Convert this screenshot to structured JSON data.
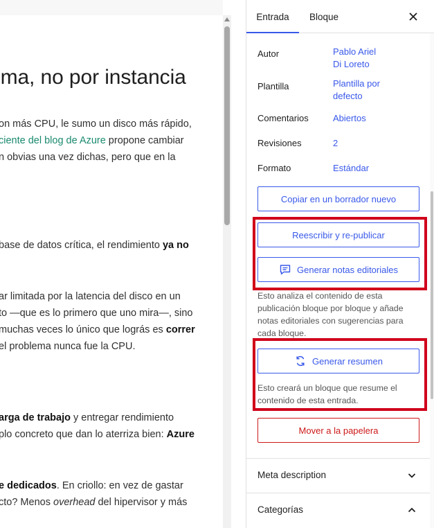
{
  "editor": {
    "title": "ema, no por instancia",
    "paragraphs": [
      [
        "on más CPU, le sumo un disco más rápido,",
        "ciente del blog de Azure propone cambiar",
        "n obvias una vez dichas, pero que en la"
      ],
      [
        "base de datos crítica, el rendimiento ",
        "ya no"
      ],
      [
        "ar limitada por la latencia del disco en un",
        "to —que es lo primero que uno mira—, sino",
        "muchas veces lo único que lográs es ",
        "correr",
        "el problema nunca fue la CPU."
      ],
      [
        "arga de trabajo",
        " y entregar rendimiento",
        "plo concreto que dan lo aterriza bien: ",
        "Azure"
      ],
      [
        "e dedicados",
        ". En criollo: en vez de gastar",
        "cto? Menos ",
        "overhead",
        " del hipervisor y más"
      ]
    ],
    "link_text": "ciente del blog de Azure",
    "link_rest": " propone cambiar"
  },
  "sidebar": {
    "tabs": [
      "Entrada",
      "Bloque"
    ],
    "cut_text": "instancia",
    "rows": {
      "autor_label": "Autor",
      "autor_value_1": "Pablo Ariel",
      "autor_value_2": "Di Loreto",
      "plantilla_label": "Plantilla",
      "plantilla_value_1": "Plantilla por",
      "plantilla_value_2": "defecto",
      "comentarios_label": "Comentarios",
      "comentarios_value": "Abiertos",
      "revisiones_label": "Revisiones",
      "revisiones_value": "2",
      "formato_label": "Formato",
      "formato_value": "Estándar"
    },
    "buttons": {
      "copy_draft": "Copiar en un borrador nuevo",
      "rewrite": "Reescribir y re-publicar",
      "editorial_notes": "Generar notas editoriales",
      "summary": "Generar resumen",
      "trash": "Mover a la papelera"
    },
    "help": {
      "editorial": "Esto analiza el contenido de esta publicación bloque por bloque y añade notas editoriales con sugerencias para cada bloque.",
      "summary": "Esto creará un bloque que resume el contenido de esta entrada."
    },
    "panels": {
      "meta": "Meta description",
      "categories": "Categorías"
    }
  },
  "colors": {
    "accent": "#3858e9",
    "danger": "#cc1818",
    "highlight": "#d0021b",
    "link_green": "#1a8a6e"
  }
}
